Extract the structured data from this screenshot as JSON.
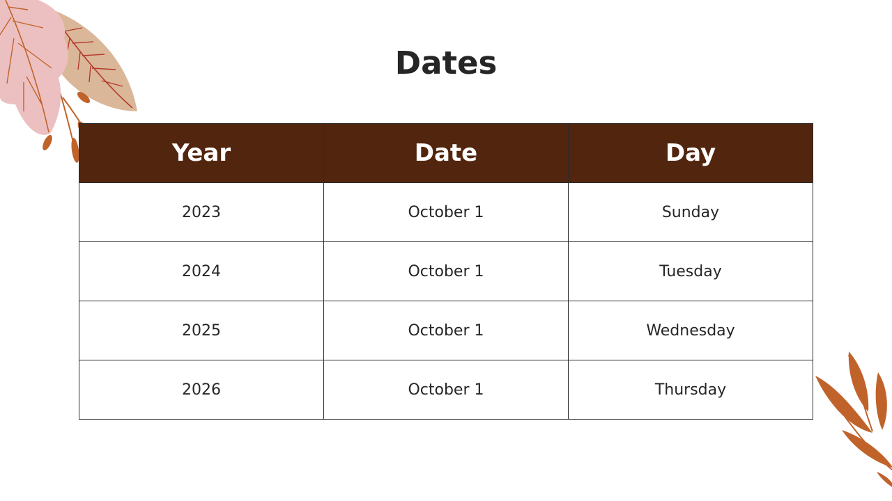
{
  "slide": {
    "title": "Dates"
  },
  "table": {
    "headers": [
      "Year",
      "Date",
      "Day"
    ],
    "rows": [
      [
        "2023",
        "October 1",
        "Sunday"
      ],
      [
        "2024",
        "October 1",
        "Tuesday"
      ],
      [
        "2025",
        "October 1",
        "Wednesday"
      ],
      [
        "2026",
        "October 1",
        "Thursday"
      ]
    ]
  },
  "colors": {
    "header_background": "#52250e",
    "header_text": "#ffffff",
    "body_text": "#262626",
    "leaf_pink": "#ecc0c0",
    "leaf_tan": "#dbb79a",
    "leaf_orange": "#c0632b",
    "leaf_vein": "#b23a2a"
  }
}
